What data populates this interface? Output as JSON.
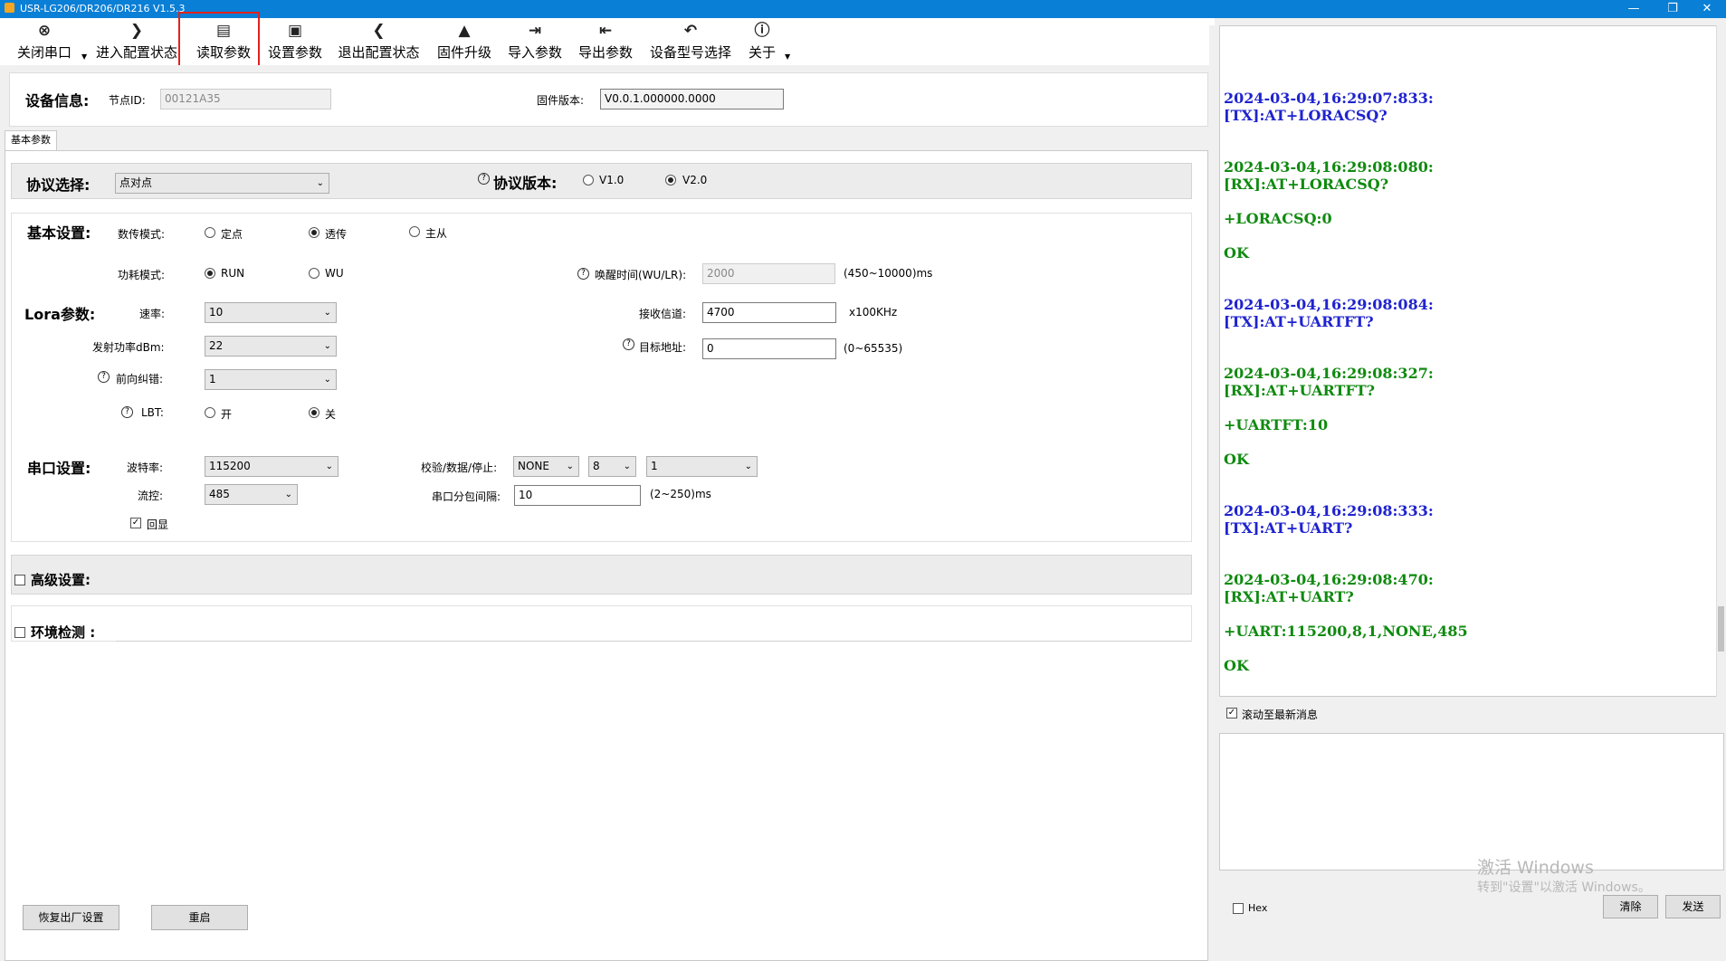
{
  "window": {
    "title": "USR-LG206/DR206/DR216 V1.5.3",
    "min": "—",
    "max": "❐",
    "close": "✕"
  },
  "toolbar": {
    "close_port": "关闭串口",
    "enter_config": "进入配置状态",
    "read_params": "读取参数",
    "set_params": "设置参数",
    "exit_config": "退出配置状态",
    "firmware_upgrade": "固件升级",
    "import_params": "导入参数",
    "export_params": "导出参数",
    "model_select": "设备型号选择",
    "about": "关于"
  },
  "device_info": {
    "heading": "设备信息:",
    "node_id_label": "节点ID:",
    "node_id_value": "00121A35",
    "firmware_label": "固件版本:",
    "firmware_value": "V0.0.1.000000.0000"
  },
  "tab": {
    "basic": "基本参数"
  },
  "protocol": {
    "heading": "协议选择:",
    "selected": "点对点",
    "version_heading": "协议版本:",
    "v1": "V1.0",
    "v2": "V2.0"
  },
  "basic": {
    "heading": "基本设置:",
    "mode_label": "数传模式:",
    "mode_fixed": "定点",
    "mode_transparent": "透传",
    "mode_master": "主从",
    "power_label": "功耗模式:",
    "power_run": "RUN",
    "power_wu": "WU",
    "wake_label": "唤醒时间(WU/LR):",
    "wake_value": "2000",
    "wake_range": "(450~10000)ms"
  },
  "lora": {
    "heading": "Lora参数:",
    "rate_label": "速率:",
    "rate_value": "10",
    "rx_channel_label": "接收信道:",
    "rx_channel_value": "4700",
    "rx_channel_unit": "x100KHz",
    "tx_power_label": "发射功率dBm:",
    "tx_power_value": "22",
    "target_label": "目标地址:",
    "target_value": "0",
    "target_range": "(0~65535)",
    "fec_label": "前向纠错:",
    "fec_value": "1",
    "lbt_label": "LBT:",
    "lbt_on": "开",
    "lbt_off": "关"
  },
  "serial": {
    "heading": "串口设置:",
    "baud_label": "波特率:",
    "baud_value": "115200",
    "parity_label": "校验/数据/停止:",
    "parity_value": "NONE",
    "data_value": "8",
    "stop_value": "1",
    "flow_label": "流控:",
    "flow_value": "485",
    "packet_label": "串口分包间隔:",
    "packet_value": "10",
    "packet_range": "(2~250)ms",
    "echo_label": "回显"
  },
  "advanced": {
    "heading": "高级设置:"
  },
  "env": {
    "heading": "环境检测 :"
  },
  "bottom": {
    "factory_reset": "恢复出厂设置",
    "restart": "重启"
  },
  "log": {
    "lines": [
      {
        "text": "2024-03-04,16:29:07:833:",
        "kind": "tx"
      },
      {
        "text": "[TX]:AT+LORACSQ?",
        "kind": "tx"
      },
      {
        "text": "2024-03-04,16:29:08:080:",
        "kind": "rx"
      },
      {
        "text": "[RX]:AT+LORACSQ?",
        "kind": "rx"
      },
      {
        "text": "+LORACSQ:0",
        "kind": "rx"
      },
      {
        "text": "OK",
        "kind": "rx"
      },
      {
        "text": "2024-03-04,16:29:08:084:",
        "kind": "tx"
      },
      {
        "text": "[TX]:AT+UARTFT?",
        "kind": "tx"
      },
      {
        "text": "2024-03-04,16:29:08:327:",
        "kind": "rx"
      },
      {
        "text": "[RX]:AT+UARTFT?",
        "kind": "rx"
      },
      {
        "text": "+UARTFT:10",
        "kind": "rx"
      },
      {
        "text": "OK",
        "kind": "rx"
      },
      {
        "text": "2024-03-04,16:29:08:333:",
        "kind": "tx"
      },
      {
        "text": "[TX]:AT+UART?",
        "kind": "tx"
      },
      {
        "text": "2024-03-04,16:29:08:470:",
        "kind": "rx"
      },
      {
        "text": "[RX]:AT+UART?",
        "kind": "rx"
      },
      {
        "text": "+UART:115200,8,1,NONE,485",
        "kind": "rx"
      },
      {
        "text": "OK",
        "kind": "rx"
      }
    ],
    "scroll_latest": "滚动至最新消息"
  },
  "send": {
    "hex": "Hex",
    "clear": "清除",
    "send": "发送"
  },
  "watermark": {
    "line1": "激活 Windows",
    "line2": "转到\"设置\"以激活 Windows。"
  },
  "colors": {
    "titlebar": "#0a7fd6",
    "tx": "#1f23cf",
    "rx": "#0f8a0f",
    "highlight": "#e3211c"
  }
}
